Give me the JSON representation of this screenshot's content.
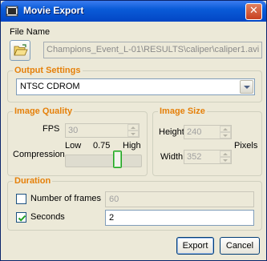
{
  "window": {
    "title": "Movie Export",
    "close_glyph": "✕"
  },
  "file": {
    "label": "File Name",
    "path": "Champions_Event_L-01\\RESULTS\\caliper\\caliper1.avi",
    "browse_icon": "folder-open-icon"
  },
  "output_settings": {
    "title": "Output Settings",
    "format": "NTSC CDROM"
  },
  "image_quality": {
    "title": "Image Quality",
    "fps_label": "FPS",
    "fps_value": "30",
    "compression_label": "Compression",
    "low_label": "Low",
    "value_label": "0.75",
    "high_label": "High",
    "compression_value": 0.75
  },
  "image_size": {
    "title": "Image Size",
    "height_label": "Height",
    "height_value": "240",
    "width_label": "Width",
    "width_value": "352",
    "units_label": "Pixels"
  },
  "duration": {
    "title": "Duration",
    "frames_label": "Number of frames",
    "frames_value": "60",
    "frames_checked": false,
    "seconds_label": "Seconds",
    "seconds_value": "2",
    "seconds_checked": true
  },
  "buttons": {
    "export": "Export",
    "cancel": "Cancel"
  },
  "colors": {
    "group_title": "#e5800a",
    "titlebar": "#0a5bd8",
    "dialog_bg": "#ece9d8"
  }
}
